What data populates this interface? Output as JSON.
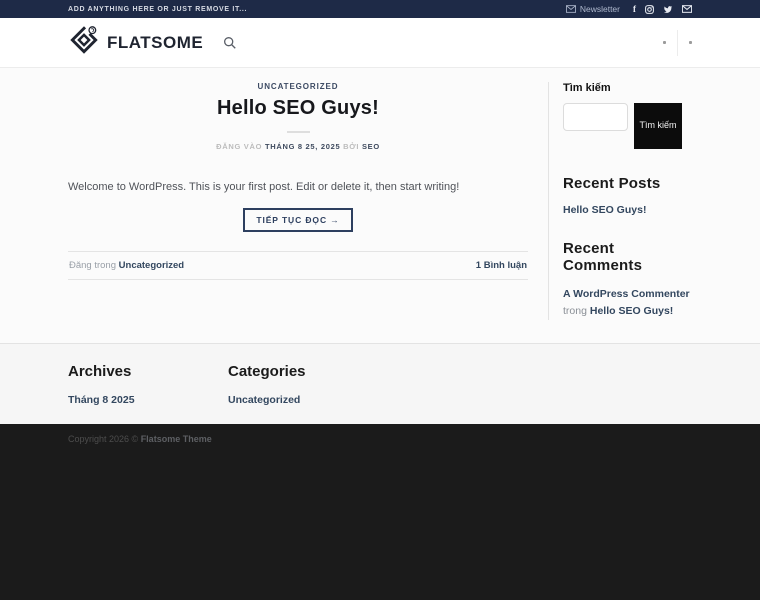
{
  "topbar": {
    "left_text": "ADD ANYTHING HERE OR JUST REMOVE IT...",
    "newsletter_label": "Newsletter",
    "social_icons": [
      "envelope-icon",
      "facebook-icon",
      "instagram-icon",
      "twitter-icon",
      "email-icon"
    ]
  },
  "header": {
    "logo_text": "FLATSOME",
    "search_icon": "search-icon"
  },
  "post": {
    "category": "UNCATEGORIZED",
    "title": "Hello SEO Guys!",
    "meta": {
      "posted_on": "ĐĂNG VÀO",
      "date": "THÁNG 8 25, 2025",
      "by": "BỞI",
      "author": "SEO"
    },
    "body": "Welcome to WordPress. This is your first post. Edit or delete it, then start writing!",
    "read_more_label": "TIẾP TỤC ĐỌC →",
    "footer": {
      "posted_in": "Đăng trong",
      "category_link": "Uncategorized",
      "comments": "1 Bình luận"
    }
  },
  "sidebar": {
    "search": {
      "label": "Tìm kiếm",
      "button_label": "Tìm kiếm",
      "input_value": ""
    },
    "recent_posts": {
      "title": "Recent Posts",
      "items": [
        "Hello SEO Guys!"
      ]
    },
    "recent_comments": {
      "title": "Recent Comments",
      "items": [
        {
          "author": "A WordPress Commenter",
          "connector": "trong",
          "post": "Hello SEO Guys!"
        }
      ]
    }
  },
  "footer_widgets": {
    "archives": {
      "title": "Archives",
      "items": [
        "Tháng 8 2025"
      ]
    },
    "categories": {
      "title": "Categories",
      "items": [
        "Uncategorized"
      ]
    }
  },
  "footer": {
    "copyright_prefix": "Copyright 2026 © ",
    "copyright_brand": "Flatsome Theme"
  },
  "colors": {
    "topbar_bg": "#1e2a47",
    "accent_navy": "#33475f",
    "button_border": "#2d3f5f",
    "search_button_bg": "#0c0c0c",
    "dark_footer_bg": "#1b1b1b",
    "content_bg": "#fbfbfb"
  }
}
